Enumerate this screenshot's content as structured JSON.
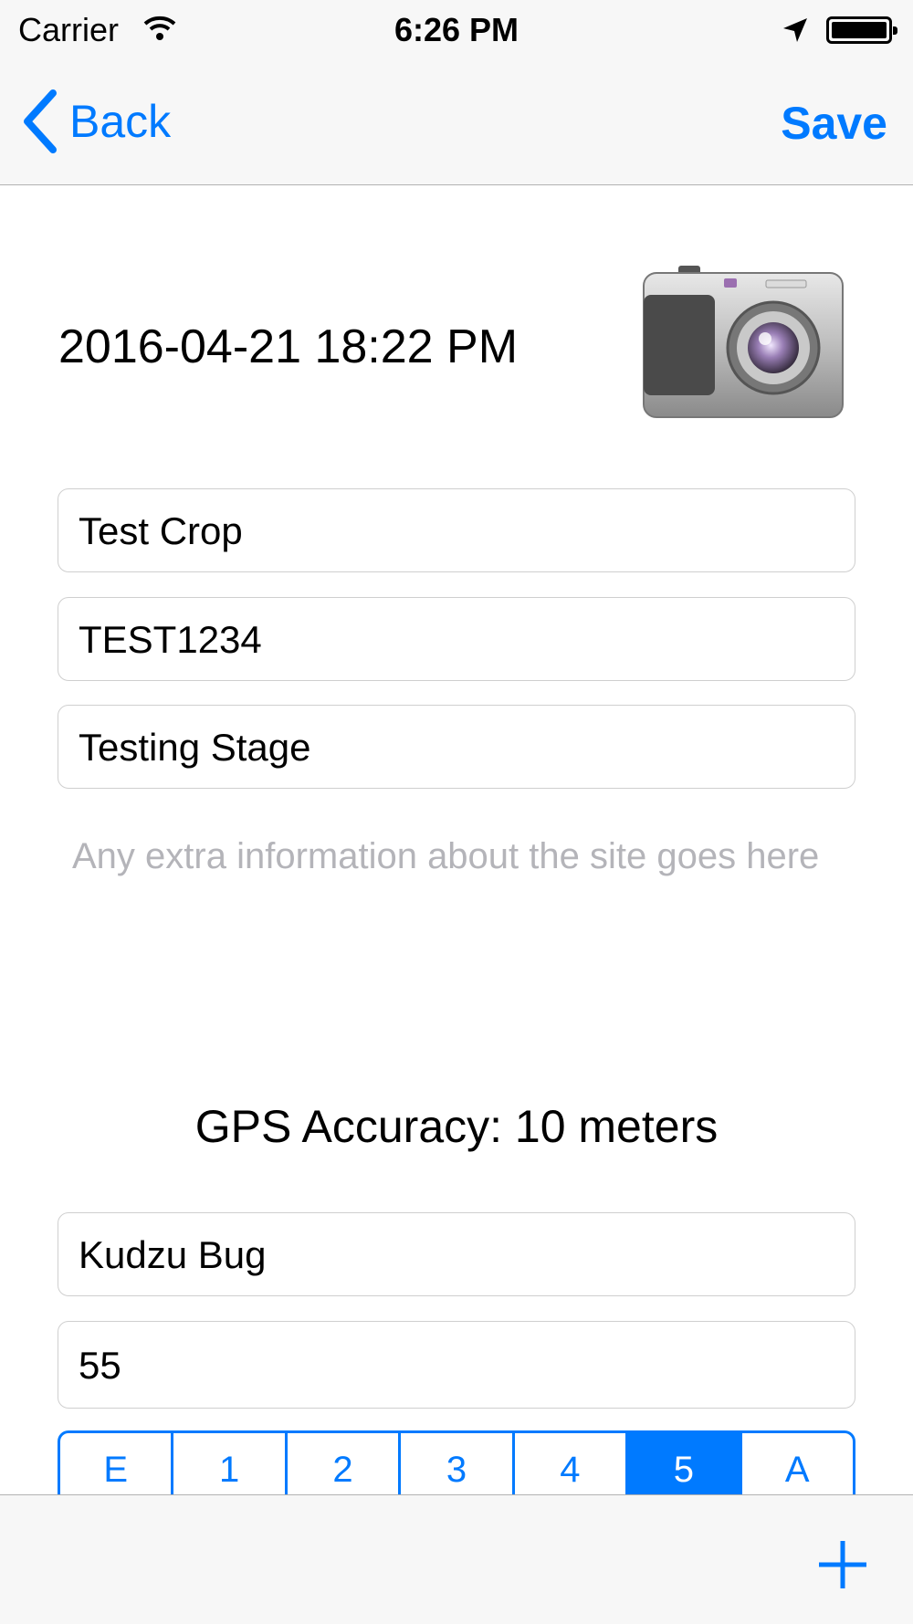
{
  "status_bar": {
    "carrier": "Carrier",
    "time": "6:26 PM"
  },
  "nav": {
    "back_label": "Back",
    "save_label": "Save"
  },
  "record": {
    "datetime": "2016-04-21 18:22 PM",
    "crop": "Test Crop",
    "code": "TEST1234",
    "stage": "Testing Stage",
    "notes_placeholder": "Any extra information about the site goes here",
    "gps_accuracy": "GPS Accuracy: 10 meters",
    "pest": "Kudzu Bug",
    "count": "55"
  },
  "segments": {
    "options": [
      "E",
      "1",
      "2",
      "3",
      "4",
      "5",
      "A"
    ],
    "selected": "5"
  },
  "colors": {
    "accent": "#007aff",
    "placeholder": "#b4b4b9",
    "bar_background": "#f7f7f7"
  },
  "icons": [
    "wifi-icon",
    "location-arrow-icon",
    "battery-icon",
    "back-chevron-icon",
    "camera-icon",
    "plus-icon"
  ]
}
